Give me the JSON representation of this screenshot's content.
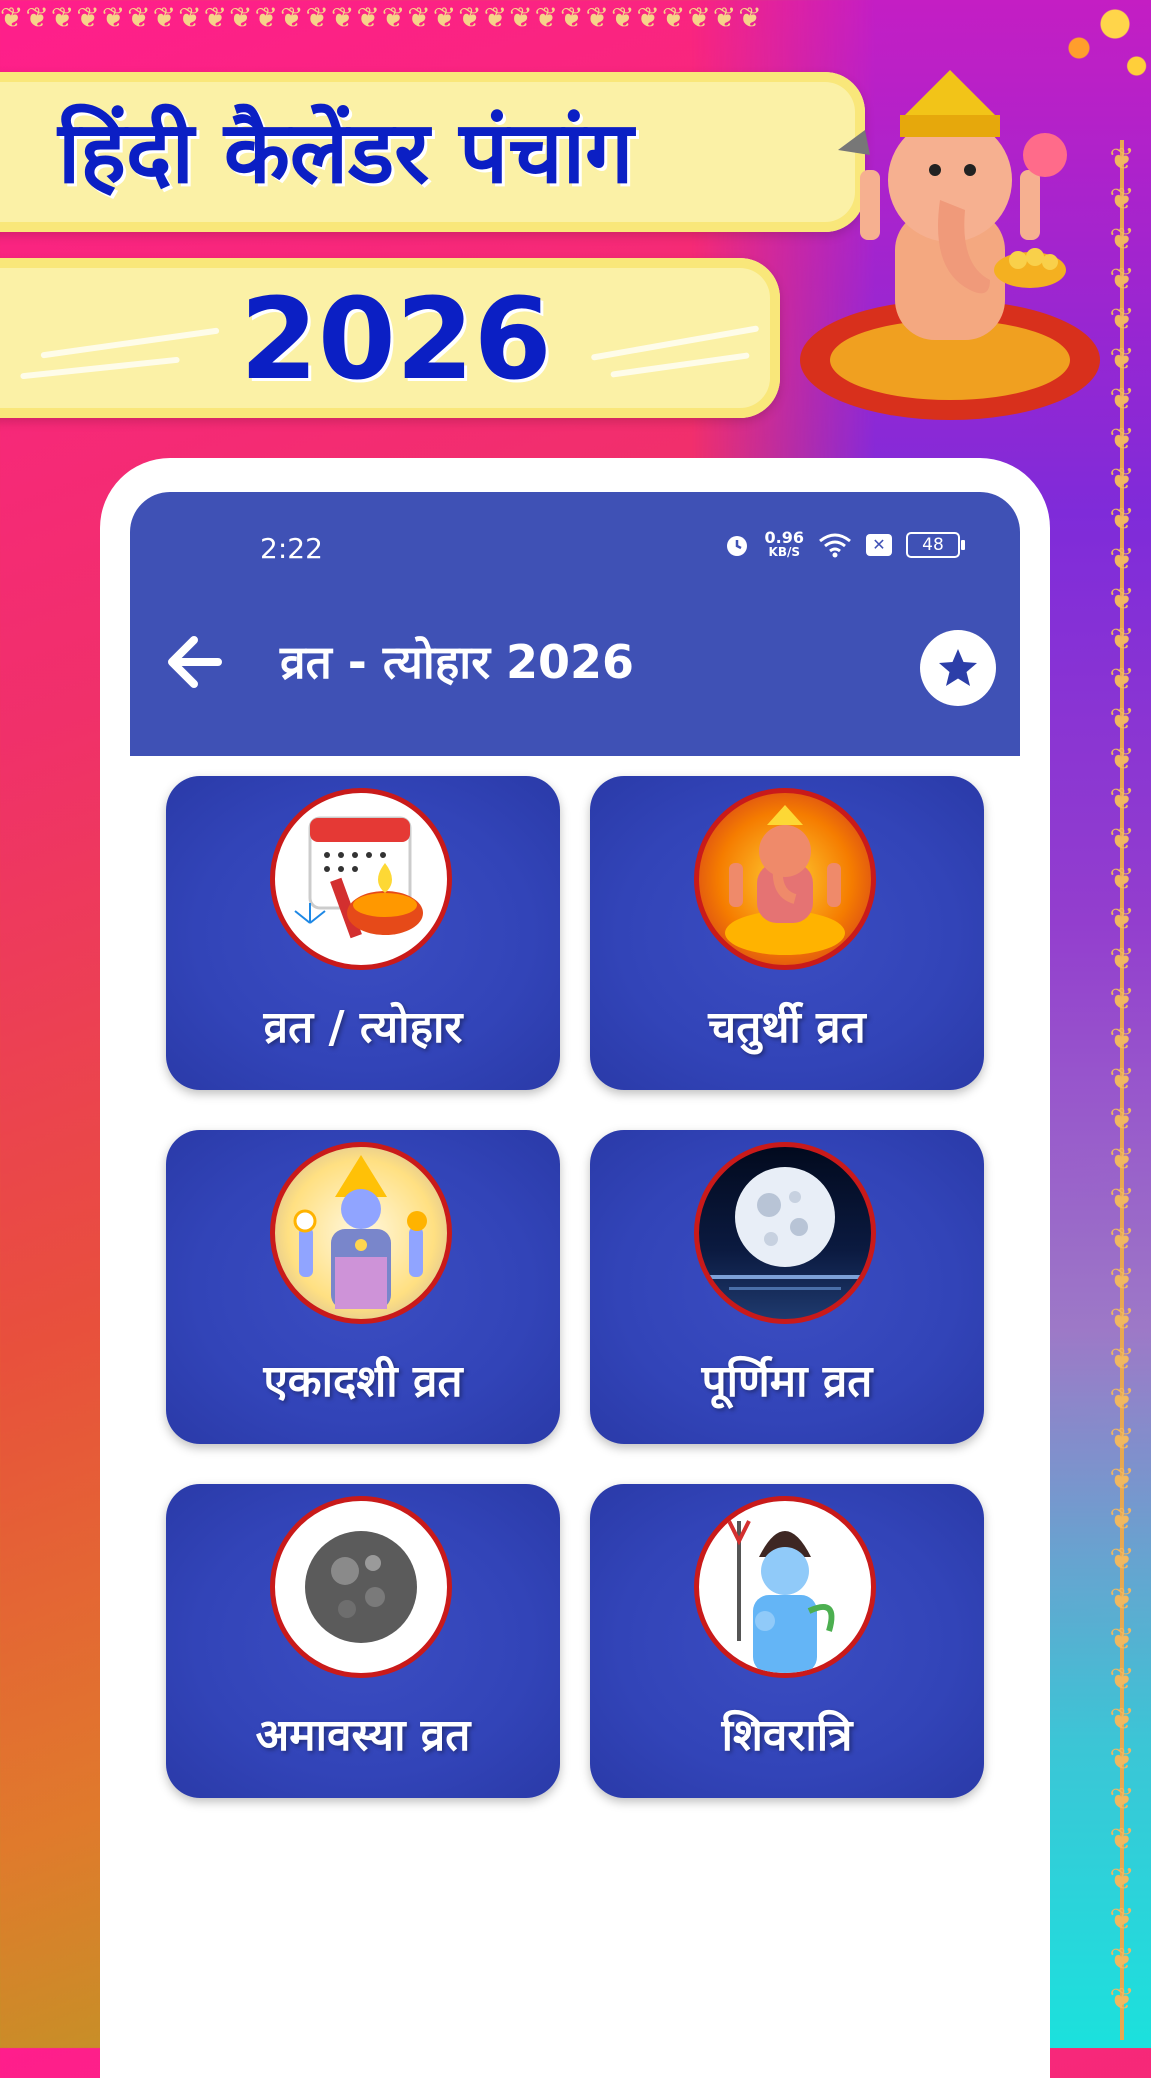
{
  "promo": {
    "title": "हिंदी कैलेंडर पंचांग",
    "year": "2026"
  },
  "status_bar": {
    "time": "2:22",
    "speed_value": "0.96",
    "speed_unit": "KB/S",
    "battery": "48"
  },
  "app_bar": {
    "title": "व्रत - त्योहार 2026"
  },
  "tiles": [
    {
      "label": "व्रत / त्योहार",
      "icon": "festival-icon"
    },
    {
      "label": "चतुर्थी व्रत",
      "icon": "ganesha-icon"
    },
    {
      "label": "एकादशी व्रत",
      "icon": "vishnu-icon"
    },
    {
      "label": "पूर्णिमा व्रत",
      "icon": "full-moon-icon"
    },
    {
      "label": "अमावस्या व्रत",
      "icon": "new-moon-icon"
    },
    {
      "label": "शिवरात्रि",
      "icon": "shiva-icon"
    }
  ],
  "colors": {
    "app_bar": "#3f51b5",
    "tile": "#3244b8",
    "promo_text": "#0b1fc4",
    "banner": "#fbf1a6"
  }
}
